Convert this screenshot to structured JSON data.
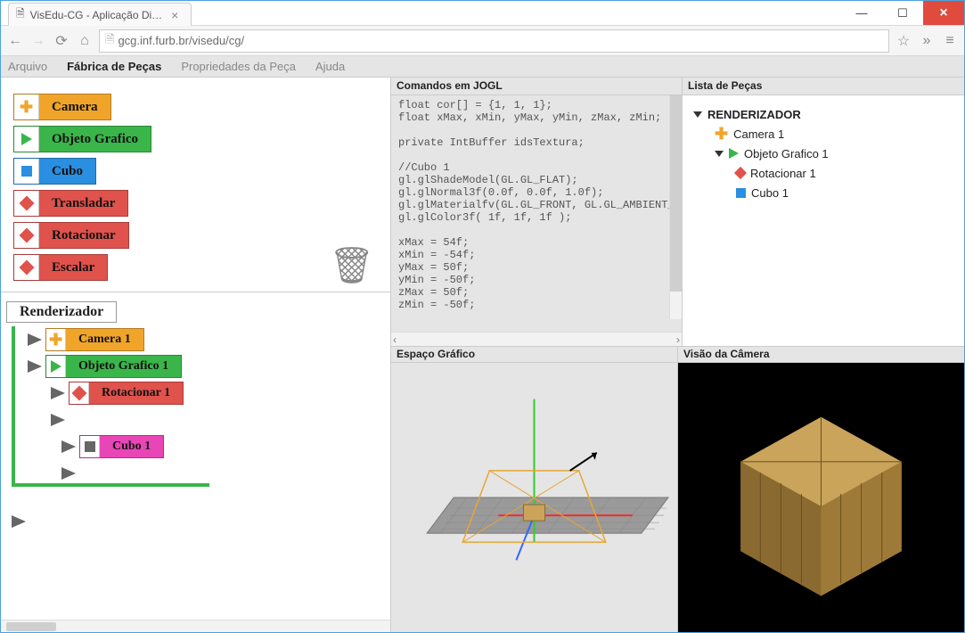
{
  "window": {
    "tab_title": "VisEdu-CG - Aplicação Di…",
    "url": "gcg.inf.furb.br/visedu/cg/"
  },
  "menubar": {
    "items": [
      "Arquivo",
      "Fábrica de Peças",
      "Propriedades da Peça",
      "Ajuda"
    ],
    "active_index": 1
  },
  "palette": {
    "pieces": [
      {
        "label": "Camera",
        "kind": "camera"
      },
      {
        "label": "Objeto Grafico",
        "kind": "obj"
      },
      {
        "label": "Cubo",
        "kind": "cubo"
      },
      {
        "label": "Transladar",
        "kind": "trans"
      },
      {
        "label": "Rotacionar",
        "kind": "rot"
      },
      {
        "label": "Escalar",
        "kind": "esc"
      }
    ]
  },
  "workspace": {
    "renderer_label": "Renderizador",
    "nodes": [
      {
        "label": "Camera 1",
        "kind": "camera",
        "depth": 1
      },
      {
        "label": "Objeto Grafico 1",
        "kind": "obj",
        "depth": 1
      },
      {
        "label": "Rotacionar 1",
        "kind": "rot",
        "depth": 2
      },
      {
        "label": "Cubo 1",
        "kind": "pink",
        "depth": 3
      }
    ]
  },
  "code_panel": {
    "title": "Comandos em JOGL",
    "code": "float cor[] = {1, 1, 1};\nfloat xMax, xMin, yMax, yMin, zMax, zMin;\n\nprivate IntBuffer idsTextura;\n\n//Cubo 1\ngl.glShadeModel(GL.GL_FLAT);\ngl.glNormal3f(0.0f, 0.0f, 1.0f);\ngl.glMaterialfv(GL.GL_FRONT, GL.GL_AMBIENT_\ngl.glColor3f( 1f, 1f, 1f );\n\nxMax = 54f;\nxMin = -54f;\nyMax = 50f;\nyMin = -50f;\nzMax = 50f;\nzMin = -50f;"
  },
  "object_tree": {
    "title": "Lista de Peças",
    "root": "RENDERIZADOR",
    "items": [
      {
        "label": "Camera 1",
        "icon": "plus",
        "depth": 1
      },
      {
        "label": "Objeto Grafico 1",
        "icon": "play",
        "depth": 1,
        "expandable": true
      },
      {
        "label": "Rotacionar 1",
        "icon": "dia",
        "depth": 2
      },
      {
        "label": "Cubo 1",
        "icon": "sq",
        "depth": 2
      }
    ]
  },
  "views": {
    "espaco": "Espaço Gráfico",
    "camera": "Visão da Câmera"
  }
}
